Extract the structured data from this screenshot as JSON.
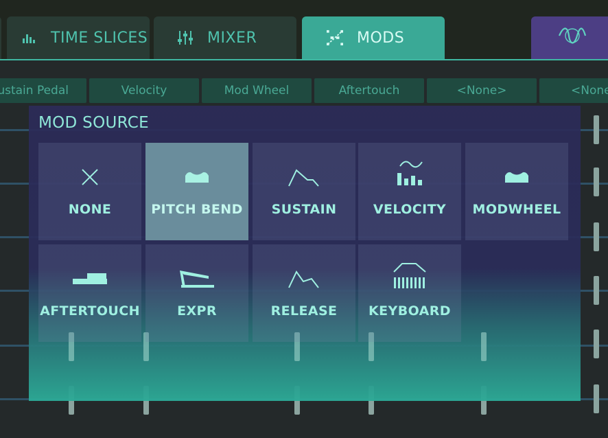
{
  "tabs": [
    {
      "id": "time",
      "label": "TIME SLICES",
      "icon": "bars-icon"
    },
    {
      "id": "mixer",
      "label": "MIXER",
      "icon": "sliders-icon"
    },
    {
      "id": "mods",
      "label": "MODS",
      "icon": "mods-icon",
      "active": true
    },
    {
      "id": "wave",
      "label": "",
      "icon": "wave-icon"
    }
  ],
  "slots": [
    "Sustain Pedal",
    "Velocity",
    "Mod Wheel",
    "Aftertouch",
    "<None>",
    "<None>"
  ],
  "overlay": {
    "title": "MOD SOURCE",
    "sources": [
      {
        "label": "NONE",
        "icon": "x-icon"
      },
      {
        "label": "PITCH BEND",
        "icon": "pitch-bend-icon",
        "selected": true
      },
      {
        "label": "SUSTAIN",
        "icon": "envelope-icon"
      },
      {
        "label": "VELOCITY",
        "icon": "velocity-icon"
      },
      {
        "label": "MODWHEEL",
        "icon": "modwheel-icon"
      },
      {
        "label": "AFTERTOUCH",
        "icon": "aftertouch-icon"
      },
      {
        "label": "EXPR",
        "icon": "pedal-icon"
      },
      {
        "label": "RELEASE",
        "icon": "release-icon"
      },
      {
        "label": "KEYBOARD",
        "icon": "keyboard-icon"
      }
    ]
  },
  "colors": {
    "accent": "#3aa996",
    "text": "#9ff0e1",
    "selected": "#6a8d9c",
    "overlay": "#2c2b58",
    "purple_tab": "#4c3e84"
  }
}
